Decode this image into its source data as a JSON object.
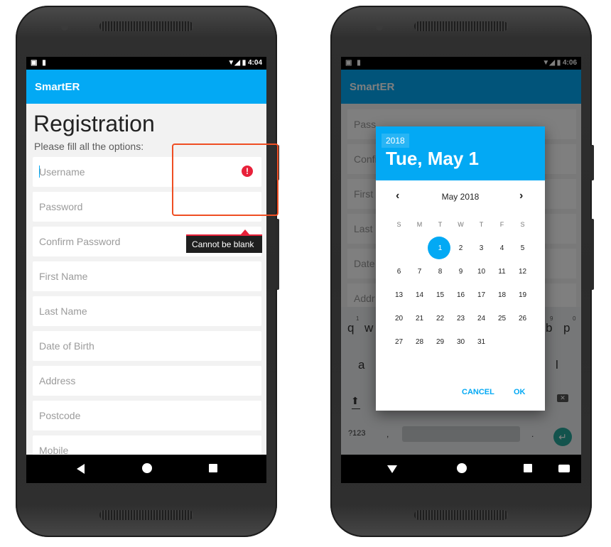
{
  "left_phone": {
    "status": {
      "left_icons": "▣ ▮",
      "right_icons": "▼◢ ▮",
      "time": "4:04"
    },
    "app_title": "SmartER",
    "page_title": "Registration",
    "subtitle": "Please fill all the options:",
    "fields": [
      {
        "placeholder": "Username"
      },
      {
        "placeholder": "Password"
      },
      {
        "placeholder": "Confirm Password"
      },
      {
        "placeholder": "First Name"
      },
      {
        "placeholder": "Last Name"
      },
      {
        "placeholder": "Date of Birth"
      },
      {
        "placeholder": "Address"
      },
      {
        "placeholder": "Postcode"
      },
      {
        "placeholder": "Mobile"
      }
    ],
    "error_icon_glyph": "!",
    "error_tooltip": "Cannot be blank"
  },
  "right_phone": {
    "status": {
      "left_icons": "▣ ▮",
      "right_icons": "▼◢ ▮",
      "time": "4:06"
    },
    "app_title": "SmartER",
    "bg_fields": [
      "Pass",
      "Confi",
      "First",
      "Last",
      "Date",
      "Addr"
    ],
    "keyboard": {
      "row1_left": "q",
      "row1_left_hint": "1",
      "row1_w": "w",
      "row1_right_p": "p",
      "row1_right_hint9": "9",
      "row1_right_hint0": "0",
      "row1_b": "b",
      "row2_left": "a",
      "row2_right": "l",
      "symbols": "?123",
      "comma": ",",
      "period": ".",
      "enter_glyph": "↵",
      "delete_glyph": "✕",
      "shift_glyph": "⬆"
    },
    "date_picker": {
      "year": "2018",
      "selected_date": "Tue, May 1",
      "month_label": "May 2018",
      "prev_glyph": "‹",
      "next_glyph": "›",
      "weekdays": [
        "S",
        "M",
        "T",
        "W",
        "T",
        "F",
        "S"
      ],
      "weeks": [
        [
          "",
          "",
          "1",
          "2",
          "3",
          "4",
          "5"
        ],
        [
          "6",
          "7",
          "8",
          "9",
          "10",
          "11",
          "12"
        ],
        [
          "13",
          "14",
          "15",
          "16",
          "17",
          "18",
          "19"
        ],
        [
          "20",
          "21",
          "22",
          "23",
          "24",
          "25",
          "26"
        ],
        [
          "27",
          "28",
          "29",
          "30",
          "31",
          "",
          ""
        ]
      ],
      "cancel_label": "CANCEL",
      "ok_label": "OK"
    }
  },
  "colors": {
    "accent": "#03a9f4",
    "error": "#e8213a",
    "highlight": "#ef4e23",
    "enter_key": "#26a69a"
  }
}
